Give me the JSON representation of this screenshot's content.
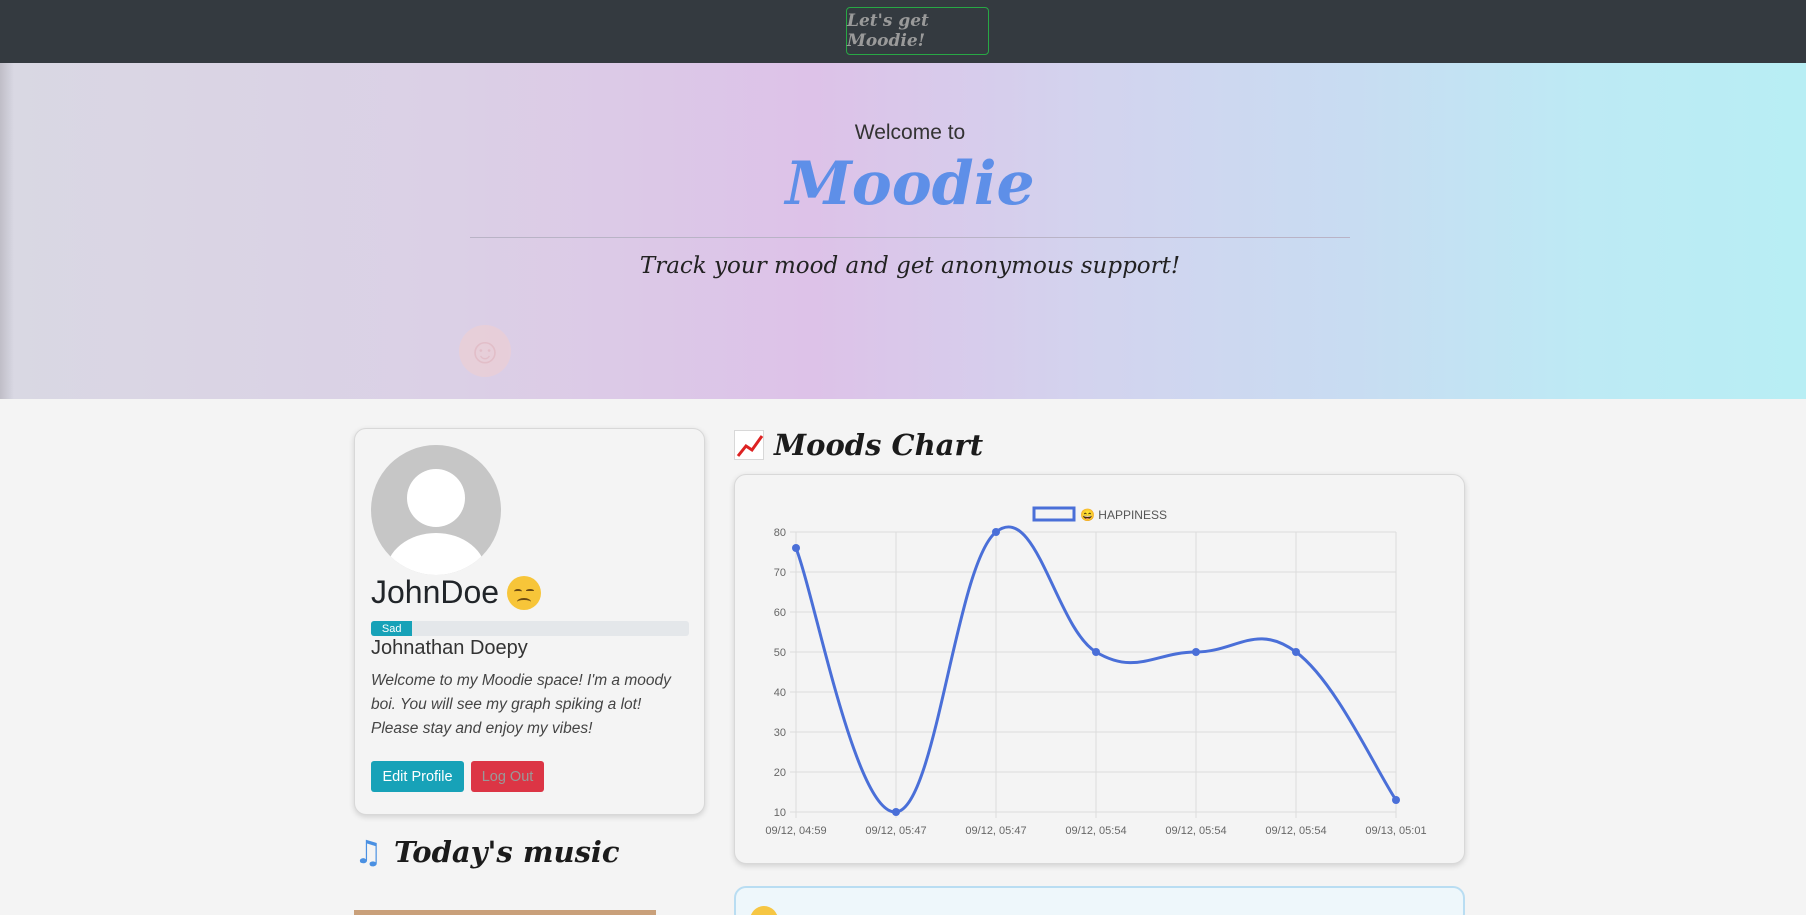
{
  "navbar": {
    "cta_label": "Let's get Moodie!"
  },
  "hero": {
    "welcome": "Welcome to",
    "brand": "Moodie",
    "tagline": "Track your mood and get anonymous support!"
  },
  "profile": {
    "username": "JohnDoe",
    "mood_label": "Sad",
    "mood_level_percent": 13,
    "full_name": "Johnathan Doepy",
    "bio": "Welcome to my Moodie space! I'm a moody boi. You will see my graph spiking a lot! Please stay and enjoy my vibes!",
    "edit_button": "Edit Profile",
    "logout_button": "Log Out"
  },
  "music": {
    "title": "Today's music"
  },
  "moods_chart": {
    "title": "Moods Chart"
  },
  "colors": {
    "accent": "#5e8fe8",
    "line": "#4a6fd8",
    "info": "#17a2b8",
    "danger": "#dc3545",
    "success": "#28a745"
  },
  "chart_data": {
    "type": "line",
    "title": "",
    "xlabel": "",
    "ylabel": "",
    "legend_position": "top",
    "grid": true,
    "x": [
      "09/12, 04:59",
      "09/12, 05:47",
      "09/12, 05:47",
      "09/12, 05:54",
      "09/12, 05:54",
      "09/12, 05:54",
      "09/13, 05:01"
    ],
    "series": [
      {
        "name": "😄 HAPPINESS",
        "values": [
          76,
          10,
          80,
          50,
          50,
          50,
          13
        ]
      }
    ],
    "ylim": [
      10,
      80
    ],
    "yticks": [
      10,
      20,
      30,
      40,
      50,
      60,
      70,
      80
    ]
  }
}
